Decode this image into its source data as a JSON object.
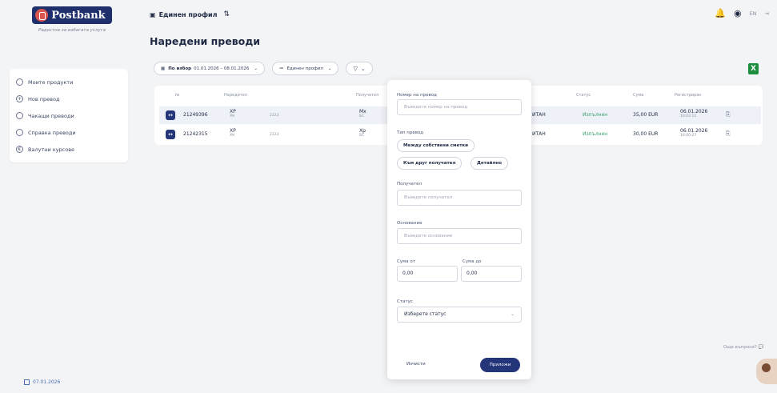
{
  "brand": {
    "name": "Postbank",
    "tagline": "Радостна за избагата услуга"
  },
  "sidebar": {
    "items": [
      {
        "label": "Моите продукти",
        "icon": "products-icon"
      },
      {
        "label": "Нов превод",
        "icon": "new-transfer-icon"
      },
      {
        "label": "Чакащи преводи",
        "icon": "pending-icon"
      },
      {
        "label": "Справка преводи",
        "icon": "report-icon"
      },
      {
        "label": "Валутни курсове",
        "icon": "currency-icon"
      }
    ],
    "date": "07.01.2026"
  },
  "topbar": {
    "profile_label": "Единен профил",
    "lang": "EN"
  },
  "page": {
    "title": "Наредени преводи"
  },
  "filters": {
    "period_label": "По избор",
    "period_value": "01.01.2026 – 08.01.2026",
    "profile_label": "Единен профил"
  },
  "table": {
    "headers": [
      "№",
      "Наредител",
      "Получател",
      "Статус",
      "Сума",
      "Регистриран"
    ],
    "rows": [
      {
        "id": "21249396",
        "payer": "ХР",
        "payer_sub": "ХК",
        "payer_mid": "2123",
        "recipient": "Мх",
        "recipient_sub": "БС",
        "channel": "ИТАН",
        "status": "Изпълнен",
        "amount": "35,00 EUR",
        "date": "06.01.2026",
        "time": "10:03:12"
      },
      {
        "id": "21242315",
        "payer": "ХР",
        "payer_sub": "ХК",
        "payer_mid": "2123",
        "recipient": "Хр",
        "recipient_sub": "БС",
        "channel": "ИТАН",
        "status": "Изпълнен",
        "amount": "30,00 EUR",
        "date": "06.01.2026",
        "time": "10:00:27"
      }
    ]
  },
  "filter_popup": {
    "order_number_label": "Номер на превод",
    "order_number_placeholder": "Въведете номер на превод",
    "type_label": "Тип превод",
    "type_options": [
      "Между собствени сметки",
      "Към друг получател",
      "Детайлно"
    ],
    "recipient_label": "Получател",
    "recipient_placeholder": "Въведете получател",
    "sender_label": "Основание",
    "sender_placeholder": "Въведете основание",
    "amount_from_label": "Сума от",
    "amount_from_value": "0,00",
    "amount_to_label": "Сума до",
    "amount_to_value": "0,00",
    "status_label": "Статус",
    "status_value": "Изберете статус",
    "clear_label": "Изчисти",
    "apply_label": "Приложи"
  },
  "help": {
    "text": "Още въпроси? 💬"
  }
}
